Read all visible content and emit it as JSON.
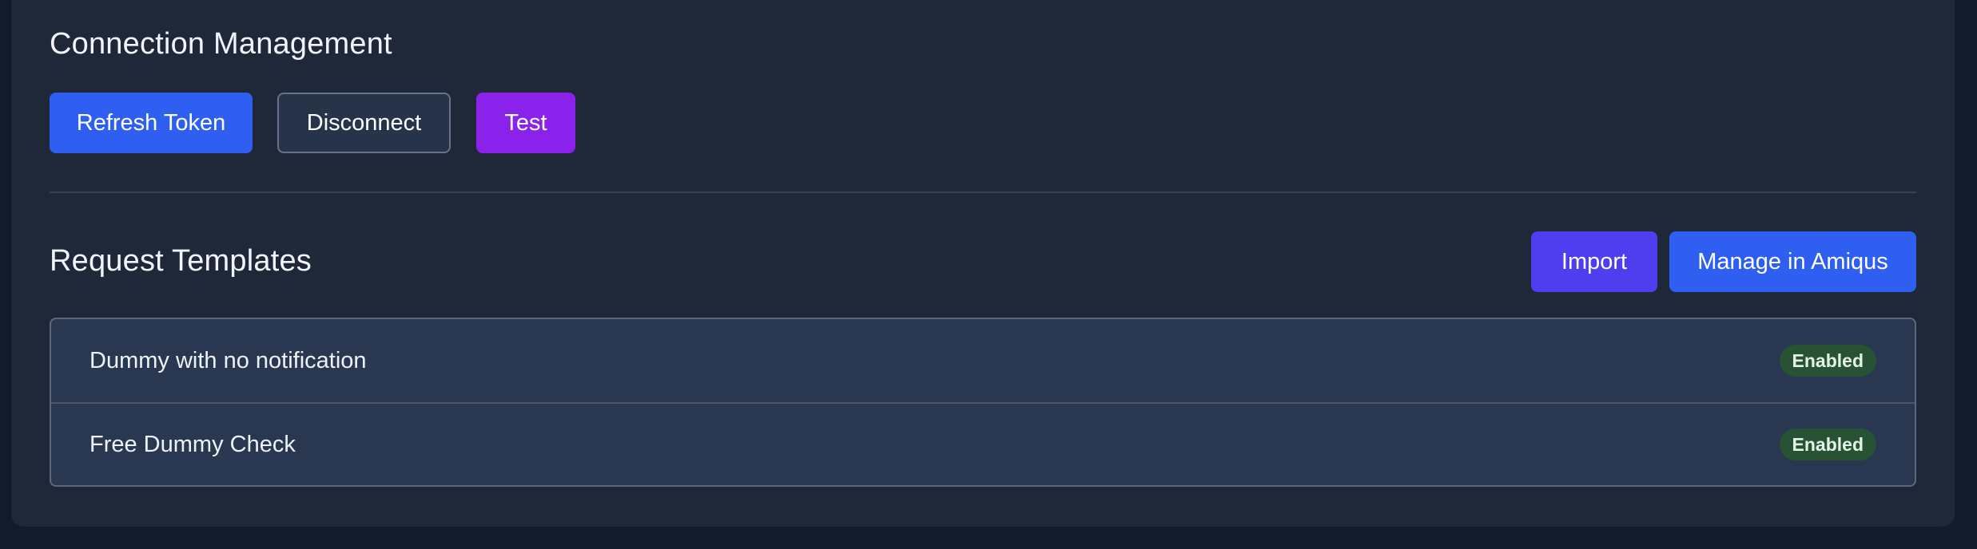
{
  "connection": {
    "title": "Connection Management",
    "refresh_label": "Refresh Token",
    "disconnect_label": "Disconnect",
    "test_label": "Test"
  },
  "templates": {
    "title": "Request Templates",
    "import_label": "Import",
    "manage_label": "Manage in Amiqus",
    "items": [
      {
        "name": "Dummy with no notification",
        "status": "Enabled"
      },
      {
        "name": "Free Dummy Check",
        "status": "Enabled"
      }
    ]
  },
  "colors": {
    "primary": "#2f5ff0",
    "test": "#8a22ec",
    "import": "#4f3ef0",
    "enabled_badge": "#275234"
  }
}
